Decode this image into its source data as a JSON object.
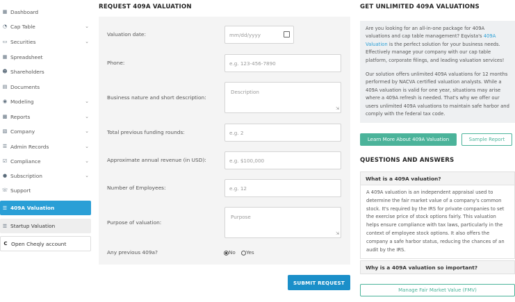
{
  "sidebar": {
    "items": [
      {
        "label": "Dashboard",
        "icon": "dashboard-icon",
        "chevron": false
      },
      {
        "label": "Cap Table",
        "icon": "pie-chart-icon",
        "chevron": true
      },
      {
        "label": "Securities",
        "icon": "document-icon",
        "chevron": true
      },
      {
        "label": "Spreadsheet",
        "icon": "spreadsheet-icon",
        "chevron": false
      },
      {
        "label": "Shareholders",
        "icon": "user-icon",
        "chevron": false
      },
      {
        "label": "Documents",
        "icon": "folder-icon",
        "chevron": false
      },
      {
        "label": "Modeling",
        "icon": "lightbulb-icon",
        "chevron": true
      },
      {
        "label": "Reports",
        "icon": "reports-icon",
        "chevron": true
      },
      {
        "label": "Company",
        "icon": "building-icon",
        "chevron": true
      },
      {
        "label": "Admin Records",
        "icon": "records-icon",
        "chevron": true
      },
      {
        "label": "Compliance",
        "icon": "checkbox-icon",
        "chevron": true
      },
      {
        "label": "Subscription",
        "icon": "dollar-icon",
        "chevron": true
      },
      {
        "label": "Support",
        "icon": "support-icon",
        "chevron": false
      }
    ],
    "active_label": "409A Valuation",
    "sub_label": "Startup Valuation",
    "open_account_label": "Open Cheqly account"
  },
  "form": {
    "title": "REQUEST 409A VALUATION",
    "fields": {
      "valuation_date": {
        "label": "Valuation date:",
        "placeholder": "mm/dd/yyyy"
      },
      "phone": {
        "label": "Phone:",
        "placeholder": "e.g. 123-456-7890"
      },
      "business": {
        "label": "Business nature and short description:",
        "placeholder": "Description"
      },
      "funding": {
        "label": "Total previous funding rounds:",
        "placeholder": "e.g. 2"
      },
      "revenue": {
        "label": "Approximate annual revenue (in USD):",
        "placeholder": "e.g. $100,000"
      },
      "employees": {
        "label": "Number of Employees:",
        "placeholder": "e.g. 12"
      },
      "purpose": {
        "label": "Purpose of valuation:",
        "placeholder": "Purpose"
      },
      "previous": {
        "label": "Any previous 409a?",
        "no": "No",
        "yes": "Yes",
        "selected": "No"
      }
    },
    "submit_label": "SUBMIT REQUEST"
  },
  "right": {
    "title": "GET UNLIMITED 409A VALUATIONS",
    "info_p1_a": "Are you looking for an all-in-one package for 409A valuations and cap table management? Eqvista's ",
    "info_p1_link": "409A Valuation",
    "info_p1_b": " is the perfect solution for your business needs. Effectively manage your company with our cap table platform, corporate filings, and leading valuation services!",
    "info_p2": "Our solution offers unlimited 409A valuations for 12 months performed by NACVA certified valuation analysts. While a 409A valuation is valid for one year, situations may arise where a 409A refresh is needed. That's why we offer our users unlimited 409A valuations to maintain safe harbor and comply with the federal tax code.",
    "learn_more_label": "Learn More About 409A Valuation",
    "sample_report_label": "Sample Report",
    "qa_title": "QUESTIONS AND ANSWERS",
    "q1": "What is a 409A valuation?",
    "a1": "A 409A valuation is an independent appraisal used to determine the fair market value of a company's common stock. It's required by the IRS for private companies to set the exercise price of stock options fairly. This valuation helps ensure compliance with tax laws, particularly in the context of employee stock options. It also offers the company a safe harbor status, reducing the chances of an audit by the IRS.",
    "q2": "Why is a 409A valuation so important?",
    "fmv_label": "Manage Fair Market Value (FMV)"
  },
  "colors": {
    "accent": "#2a9fd6",
    "submit": "#1b8fc9",
    "teal": "#4bb39a"
  }
}
